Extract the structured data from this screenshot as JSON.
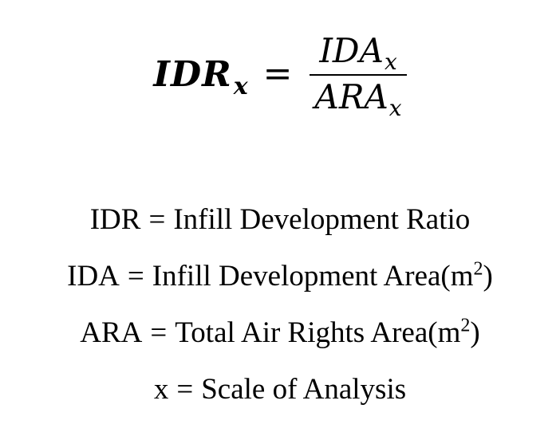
{
  "equation": {
    "lhs_base": "IDR",
    "lhs_sub": "x",
    "equals": "=",
    "numerator_base": "IDA",
    "numerator_sub": "x",
    "denominator_base": "ARA",
    "denominator_sub": "x"
  },
  "definitions": [
    {
      "term": "IDR",
      "equals": "=",
      "meaning": "Infill Development Ratio",
      "unit_open": "",
      "unit_base": "",
      "unit_sup": "",
      "unit_close": ""
    },
    {
      "term": "IDA",
      "equals": "=",
      "meaning": "Infill Development Area",
      "unit_open": " (",
      "unit_base": "m",
      "unit_sup": "2",
      "unit_close": ")"
    },
    {
      "term": "ARA",
      "equals": "=",
      "meaning": "Total Air Rights Area",
      "unit_open": " (",
      "unit_base": "m",
      "unit_sup": "2",
      "unit_close": ")"
    },
    {
      "term": "x",
      "equals": "=",
      "meaning": "Scale of Analysis",
      "unit_open": "",
      "unit_base": "",
      "unit_sup": "",
      "unit_close": ""
    }
  ]
}
